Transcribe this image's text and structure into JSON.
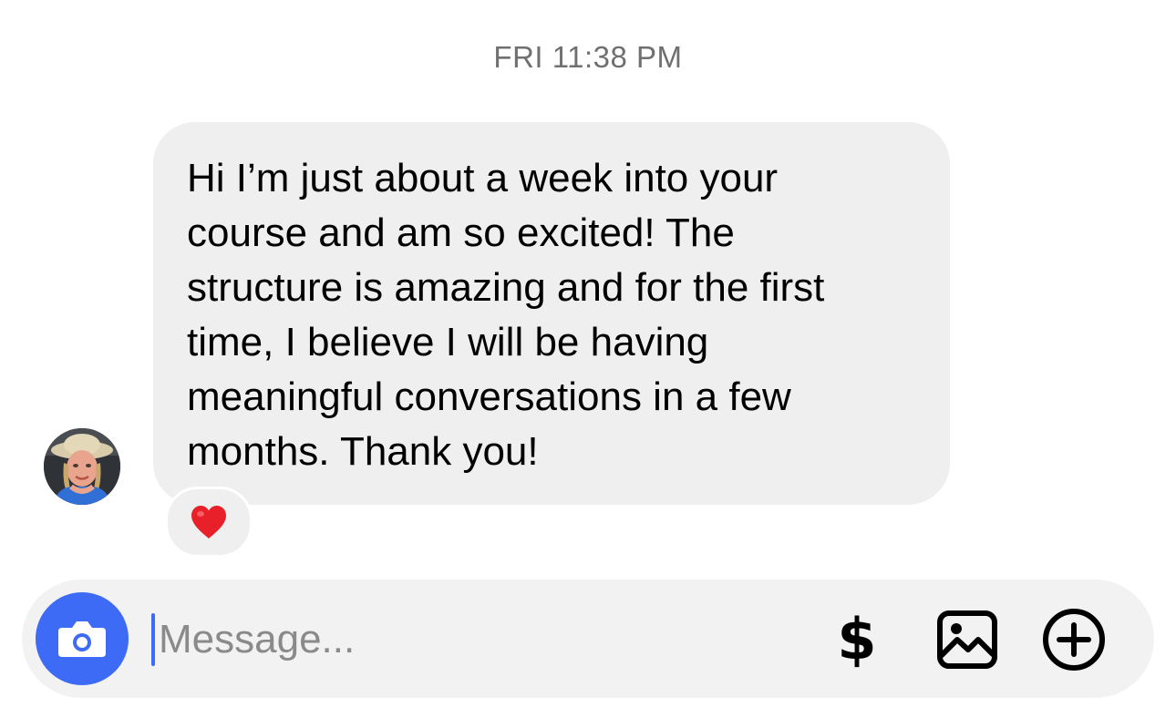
{
  "thread": {
    "timestamp": "FRI 11:38 PM"
  },
  "message": {
    "text": "Hi I’m just about a week into your\ncourse and am so excited! The\nstructure is amazing and for the first\ntime, I believe I will be having\nmeaningful conversations in a few\nmonths. Thank you!",
    "reaction": "❤️"
  },
  "composer": {
    "placeholder": "Message...",
    "value": "",
    "dollar_symbol": "$",
    "accent_color": "#3d6bf5",
    "icons": [
      "camera-icon",
      "dollar-icon",
      "gallery-icon",
      "plus-circle-icon"
    ]
  },
  "colors": {
    "bubble": "#efefef",
    "composer": "#f2f2f2",
    "timestamp": "#707070",
    "heart": "#e8202a"
  }
}
